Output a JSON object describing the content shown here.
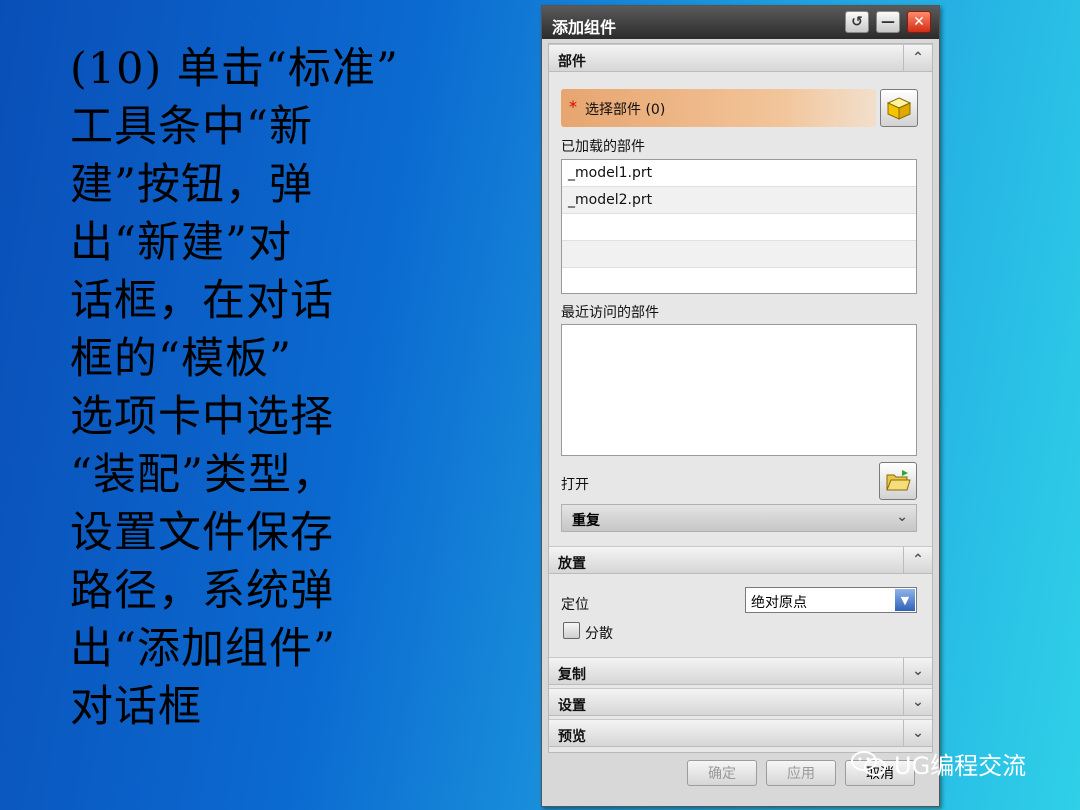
{
  "slide": {
    "lines": [
      "(10) 单击“标准”",
      "工具条中“新",
      "建”按钮，弹",
      "出“新建”对",
      "话框，在对话",
      "框的“模板”",
      "选项卡中选择",
      "“装配”类型，",
      "设置文件保存",
      "路径，系统弹",
      "出“添加组件”",
      "对话框"
    ]
  },
  "dialog": {
    "title": "添加组件",
    "titlebar_icons": [
      "reset-icon",
      "minimize-icon",
      "close-icon"
    ],
    "part_section": {
      "header": "部件",
      "select_label": "选择部件 (0)",
      "loaded_label": "已加载的部件",
      "loaded_items": [
        "_model1.prt",
        "_model2.prt",
        "",
        "",
        ""
      ],
      "recent_label": "最近访问的部件",
      "open_label": "打开",
      "repeat_label": "重复"
    },
    "placement_section": {
      "header": "放置",
      "position_label": "定位",
      "position_value": "绝对原点",
      "scatter_label": "分散",
      "scatter_checked": false
    },
    "collapsed_sections": [
      "复制",
      "设置",
      "预览"
    ],
    "footer": {
      "ok": "确定",
      "apply": "应用",
      "cancel": "取消"
    }
  },
  "watermark": "UG编程交流",
  "colors": {
    "select_bar": "#e7a56f",
    "required_star": "#e00000"
  }
}
